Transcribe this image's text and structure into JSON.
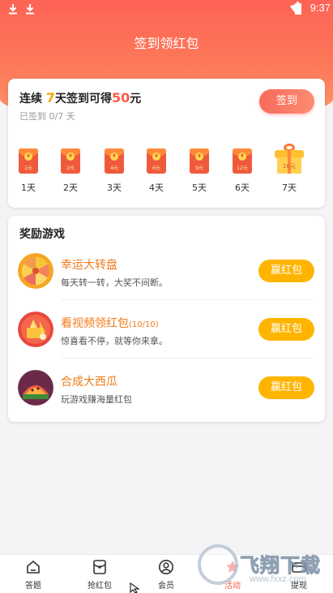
{
  "status_bar": {
    "time": "9:37"
  },
  "header": {
    "title": "签到领红包"
  },
  "signin": {
    "prefix": "连续",
    "days": "7",
    "middle": "天签到可得",
    "amount": "50",
    "suffix": "元",
    "progress_text": "已签到 0/7 天",
    "progress": {
      "signed": 0,
      "total": 7
    },
    "button_label": "签到",
    "days_list": [
      {
        "label": "1天",
        "reward": "1元"
      },
      {
        "label": "2天",
        "reward": "2元"
      },
      {
        "label": "3天",
        "reward": "4元"
      },
      {
        "label": "4天",
        "reward": "6元"
      },
      {
        "label": "5天",
        "reward": "9元"
      },
      {
        "label": "6天",
        "reward": "12元"
      },
      {
        "label": "7天",
        "reward": "16元"
      }
    ],
    "coin_symbol": "¥"
  },
  "games": {
    "title": "奖励游戏",
    "items": [
      {
        "name": "幸运大转盘",
        "count": "",
        "desc": "每天转一转，大奖不间断。",
        "button": "赢红包"
      },
      {
        "name": "看视频领红包",
        "count": "(10/10)",
        "desc": "惊喜看不停，就等你来拿。",
        "button": "赢红包"
      },
      {
        "name": "合成大西瓜",
        "count": "",
        "desc": "玩游戏赚海量红包",
        "button": "赢红包"
      }
    ]
  },
  "tabbar": {
    "items": [
      {
        "label": "答题",
        "icon": "home-icon"
      },
      {
        "label": "抢红包",
        "icon": "red-packet-icon"
      },
      {
        "label": "会员",
        "icon": "user-icon"
      },
      {
        "label": "活动",
        "icon": "activity-icon"
      },
      {
        "label": "提现",
        "icon": "withdraw-icon"
      }
    ],
    "active_index": 3
  },
  "watermark": {
    "text": "飞翔下载",
    "url": "www.fxxz.com"
  },
  "colors": {
    "header_gradient_top": "#fd6356",
    "accent_red": "#fb5a4c",
    "accent_orange": "#f07a1a",
    "button_yellow": "#ffb400",
    "highlight_gold": "#f7a800"
  }
}
